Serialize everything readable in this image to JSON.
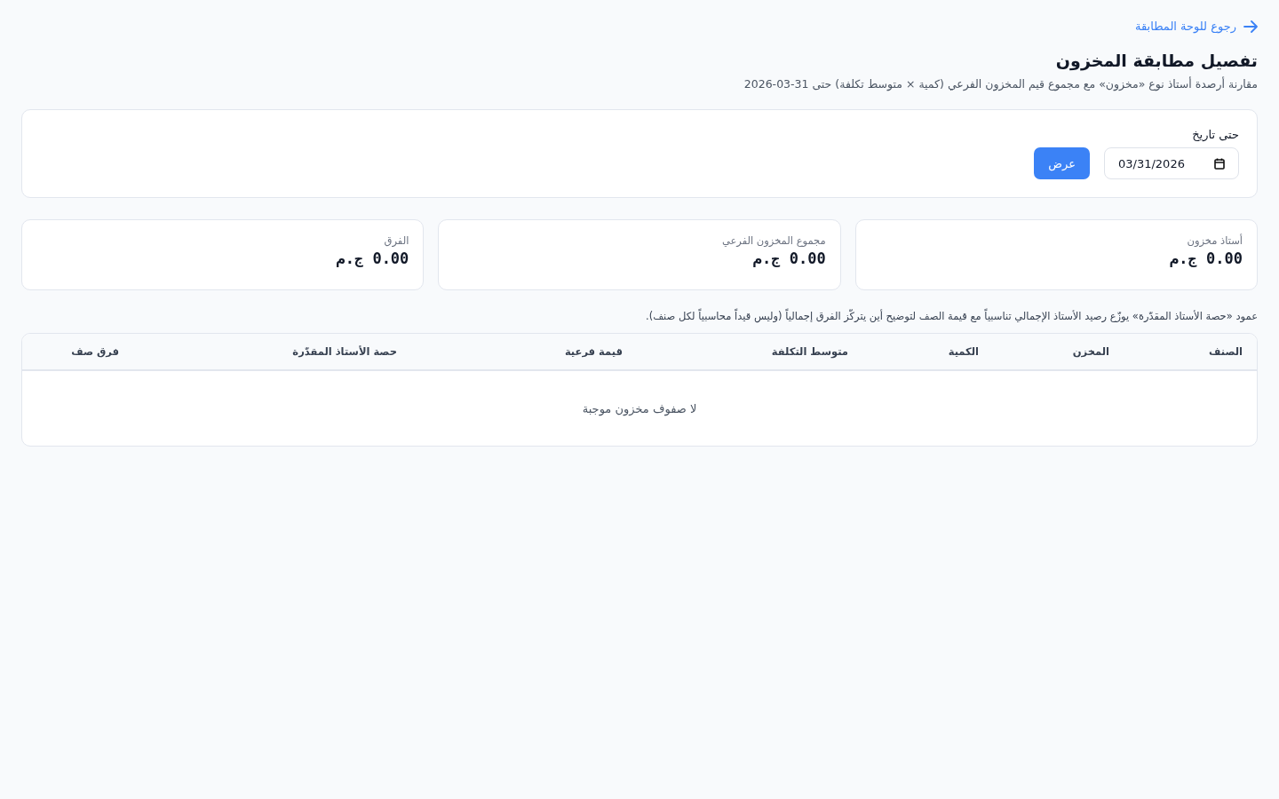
{
  "back_link": {
    "label": "رجوع للوحة المطابقة"
  },
  "page_title": "تفصيل مطابقة المخزون",
  "subtitle": "مقارنة أرصدة أستاذ نوع «مخزون» مع مجموع قيم المخزون الفرعي (كمية × متوسط تكلفة) حتى 31-03-2026",
  "filter": {
    "label": "حتى تاريخ",
    "date_value": "03/31/2026",
    "submit": "عرض"
  },
  "summary_cards": [
    {
      "label": "أستاذ مخزون",
      "value": "0.00 ج.م"
    },
    {
      "label": "مجموع المخزون الفرعي",
      "value": "0.00 ج.م"
    },
    {
      "label": "الفرق",
      "value": "0.00 ج.م"
    }
  ],
  "note": "عمود «حصة الأستاذ المقدّرة» يوزّع رصيد الأستاذ الإجمالي تناسبياً مع قيمة الصف لتوضيح أين يتركّز الفرق إجمالياً (وليس قيداً محاسبياً لكل صنف).",
  "table": {
    "columns": [
      "الصنف",
      "المخزن",
      "الكمية",
      "متوسط التكلفة",
      "قيمة فرعية",
      "حصة الأستاذ المقدّرة",
      "فرق صف"
    ],
    "empty_message": "لا صفوف مخزون موجبة"
  }
}
